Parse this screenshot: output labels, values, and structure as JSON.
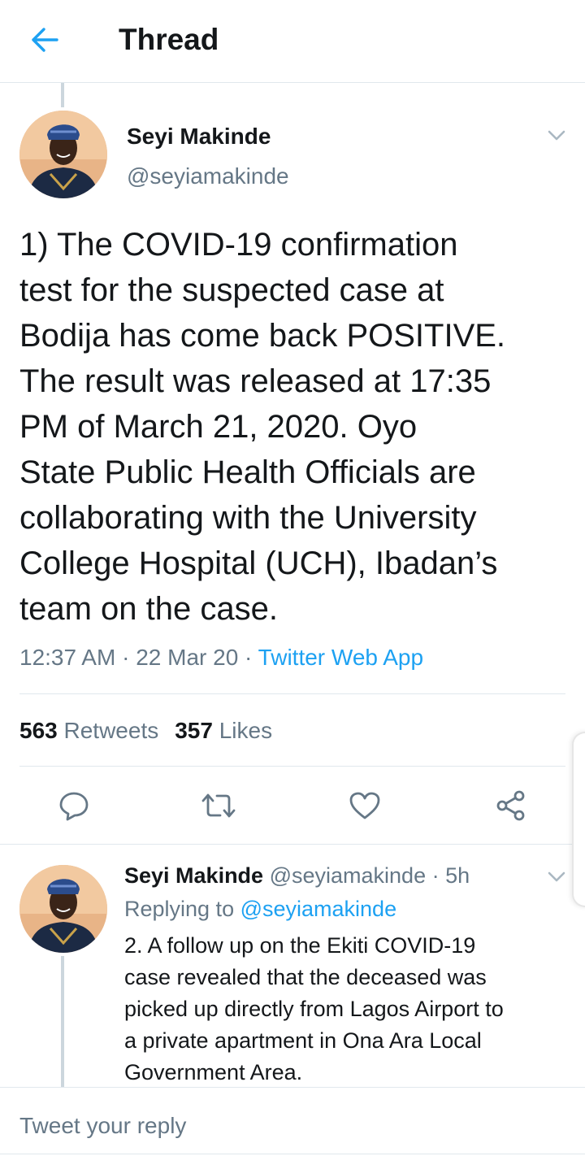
{
  "header": {
    "title": "Thread"
  },
  "tweet": {
    "author_name": "Seyi Makinde",
    "author_handle": "@seyiamakinde",
    "text": "1) The COVID-19 confirmation\ntest for the suspected case at\nBodija has come back POSITIVE.\nThe result was released at 17:35\nPM of March 21, 2020. Oyo\nState Public Health Officials are\ncollaborating with the University\nCollege Hospital (UCH), Ibadan’s\nteam on the case.",
    "time": "12:37 AM",
    "separator": " · ",
    "date": "22 Mar 20",
    "source": "Twitter Web App",
    "retweets_count": "563",
    "retweets_label": "Retweets",
    "likes_count": "357",
    "likes_label": "Likes"
  },
  "actions": {
    "reply_icon": "reply-icon",
    "retweet_icon": "retweet-icon",
    "like_icon": "heart-icon",
    "share_icon": "share-icon"
  },
  "reply": {
    "author_name": "Seyi Makinde",
    "author_handle": "@seyiamakinde",
    "age": " · 5h",
    "replying_prefix": "Replying to ",
    "replying_to": "@seyiamakinde",
    "text": "2.  A follow up on the Ekiti COVID-19\ncase revealed that the deceased was\npicked up directly from Lagos Airport to\na private apartment in Ona Ara Local\nGovernment Area."
  },
  "compose": {
    "placeholder": "Tweet your reply"
  },
  "colors": {
    "accent": "#1da1f2",
    "secondary_text": "#657786",
    "primary_text": "#14171a",
    "divider": "#e1e8ed"
  }
}
